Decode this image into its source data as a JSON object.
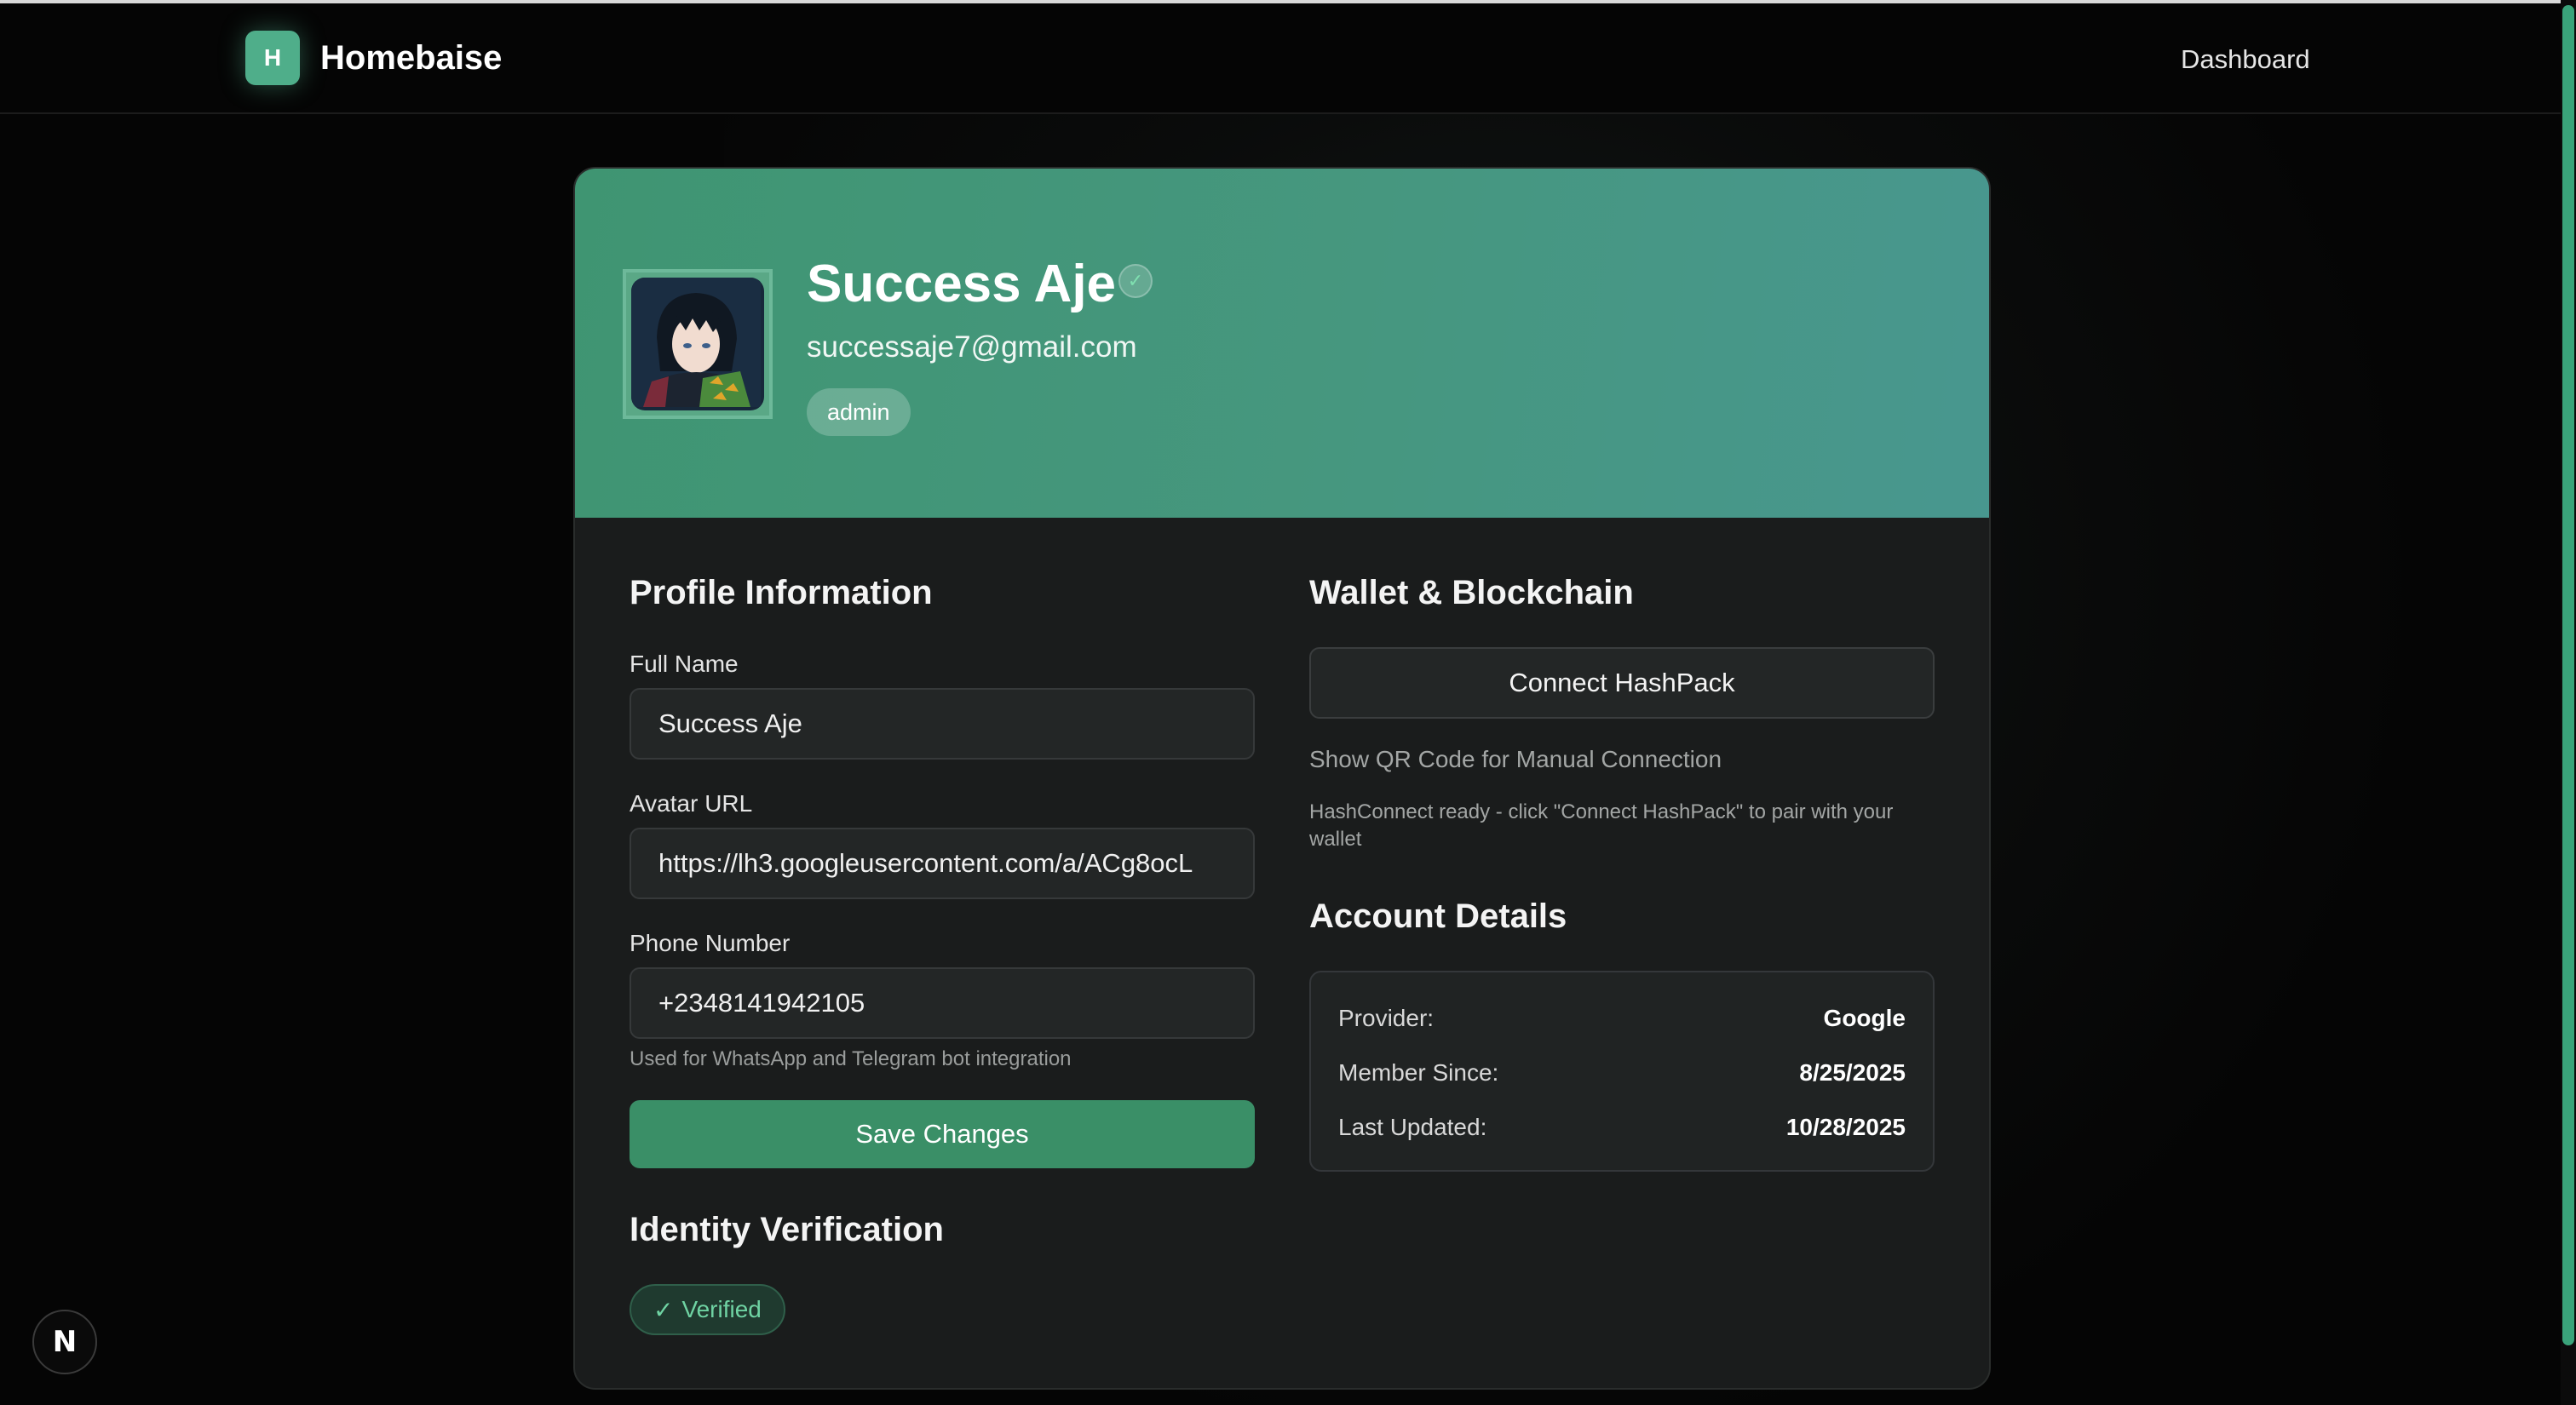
{
  "header": {
    "logo_letter": "H",
    "brand": "Homebaise",
    "nav_dashboard": "Dashboard"
  },
  "profile": {
    "name": "Success Aje",
    "verified_icon": "check-circle-icon",
    "email": "successaje7@gmail.com",
    "role": "admin"
  },
  "profile_info": {
    "title": "Profile Information",
    "full_name_label": "Full Name",
    "full_name_value": "Success Aje",
    "avatar_url_label": "Avatar URL",
    "avatar_url_value": "https://lh3.googleusercontent.com/a/ACg8ocL",
    "phone_label": "Phone Number",
    "phone_value": "+2348141942105",
    "phone_hint": "Used for WhatsApp and Telegram bot integration",
    "save_label": "Save Changes"
  },
  "identity": {
    "title": "Identity Verification",
    "check": "✓",
    "status": "Verified"
  },
  "wallet": {
    "title": "Wallet & Blockchain",
    "connect_label": "Connect HashPack",
    "qr_link": "Show QR Code for Manual Connection",
    "status_text": "HashConnect ready - click \"Connect HashPack\" to pair with your wallet"
  },
  "account": {
    "title": "Account Details",
    "rows": [
      {
        "key": "Provider:",
        "value": "Google"
      },
      {
        "key": "Member Since:",
        "value": "8/25/2025"
      },
      {
        "key": "Last Updated:",
        "value": "10/28/2025"
      }
    ]
  },
  "dev_badge": "N",
  "colors": {
    "accent": "#3a8f67",
    "hero_start": "#3f9572",
    "hero_end": "#48978f",
    "background": "#050505"
  }
}
